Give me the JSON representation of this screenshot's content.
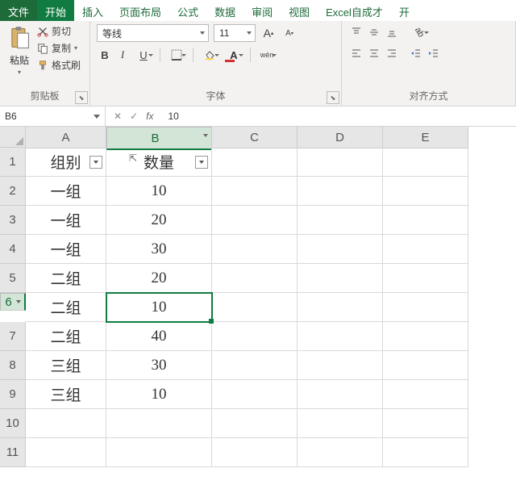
{
  "tabs": {
    "file": "文件",
    "home": "开始",
    "insert": "插入",
    "layout": "页面布局",
    "formula": "公式",
    "data": "数据",
    "review": "审阅",
    "view": "视图",
    "custom": "Excel自成才",
    "more": "开"
  },
  "ribbon": {
    "clipboard": {
      "label": "剪贴板",
      "paste": "粘贴",
      "cut": "剪切",
      "copy": "复制",
      "painter": "格式刷"
    },
    "font": {
      "label": "字体",
      "name": "等线",
      "size": "11",
      "bold": "B",
      "italic": "I",
      "underline": "U",
      "wen": "wén"
    },
    "align": {
      "label": "对齐方式"
    }
  },
  "namebox": "B6",
  "formula_value": "10",
  "columns": [
    "A",
    "B",
    "C",
    "D",
    "E"
  ],
  "rows": [
    "1",
    "2",
    "3",
    "4",
    "5",
    "6",
    "7",
    "8",
    "9",
    "10",
    "11"
  ],
  "headers": [
    "组别",
    "数量"
  ],
  "data": [
    [
      "一组",
      "10"
    ],
    [
      "一组",
      "20"
    ],
    [
      "一组",
      "30"
    ],
    [
      "二组",
      "20"
    ],
    [
      "二组",
      "10"
    ],
    [
      "二组",
      "40"
    ],
    [
      "三组",
      "30"
    ],
    [
      "三组",
      "10"
    ]
  ],
  "active": {
    "row": 6,
    "col": 2
  },
  "chart_data": {
    "type": "table",
    "columns": [
      "组别",
      "数量"
    ],
    "rows": [
      [
        "一组",
        10
      ],
      [
        "一组",
        20
      ],
      [
        "一组",
        30
      ],
      [
        "二组",
        20
      ],
      [
        "二组",
        10
      ],
      [
        "二组",
        40
      ],
      [
        "三组",
        30
      ],
      [
        "三组",
        10
      ]
    ]
  }
}
